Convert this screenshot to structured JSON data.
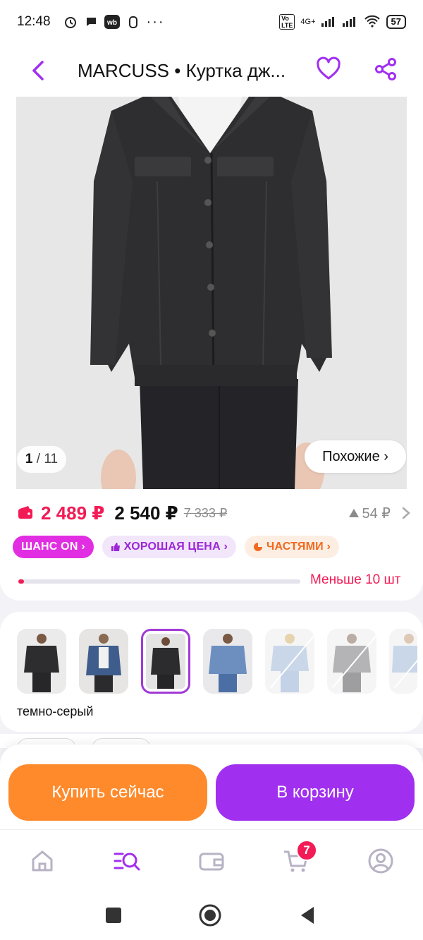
{
  "status_bar": {
    "time": "12:48",
    "network": "4G+",
    "battery": "57"
  },
  "header": {
    "title": "MARCUSS • Куртка дж..."
  },
  "gallery": {
    "counter_current": "1",
    "counter_total": "/ 11",
    "similar_label": "Похожие ›"
  },
  "price": {
    "wallet_price": "2 489 ₽",
    "current_price": "2 540 ₽",
    "old_price": "7 333 ₽",
    "diff": "54 ₽"
  },
  "chips": {
    "chance": "ШАНС ON ›",
    "good_price": "ХОРОШАЯ ЦЕНА ›",
    "installments": "ЧАСТЯМИ ›"
  },
  "stock": {
    "text": "Меньше 10 шт",
    "level": 0.01
  },
  "variants": {
    "selected_label": "темно-серый",
    "items": [
      {
        "name": "black",
        "available": true
      },
      {
        "name": "blue",
        "available": true
      },
      {
        "name": "dark-grey",
        "available": true,
        "selected": true
      },
      {
        "name": "light-blue",
        "available": true
      },
      {
        "name": "light-blue-2",
        "available": false
      },
      {
        "name": "grey",
        "available": false
      },
      {
        "name": "light-blue-3",
        "available": false
      }
    ]
  },
  "actions": {
    "buy_now": "Купить сейчас",
    "add_to_cart": "В корзину"
  },
  "tabbar": {
    "cart_badge": "7"
  },
  "colors": {
    "accent": "#a12ff0",
    "red": "#f21b55",
    "orange": "#ff8a2b"
  }
}
